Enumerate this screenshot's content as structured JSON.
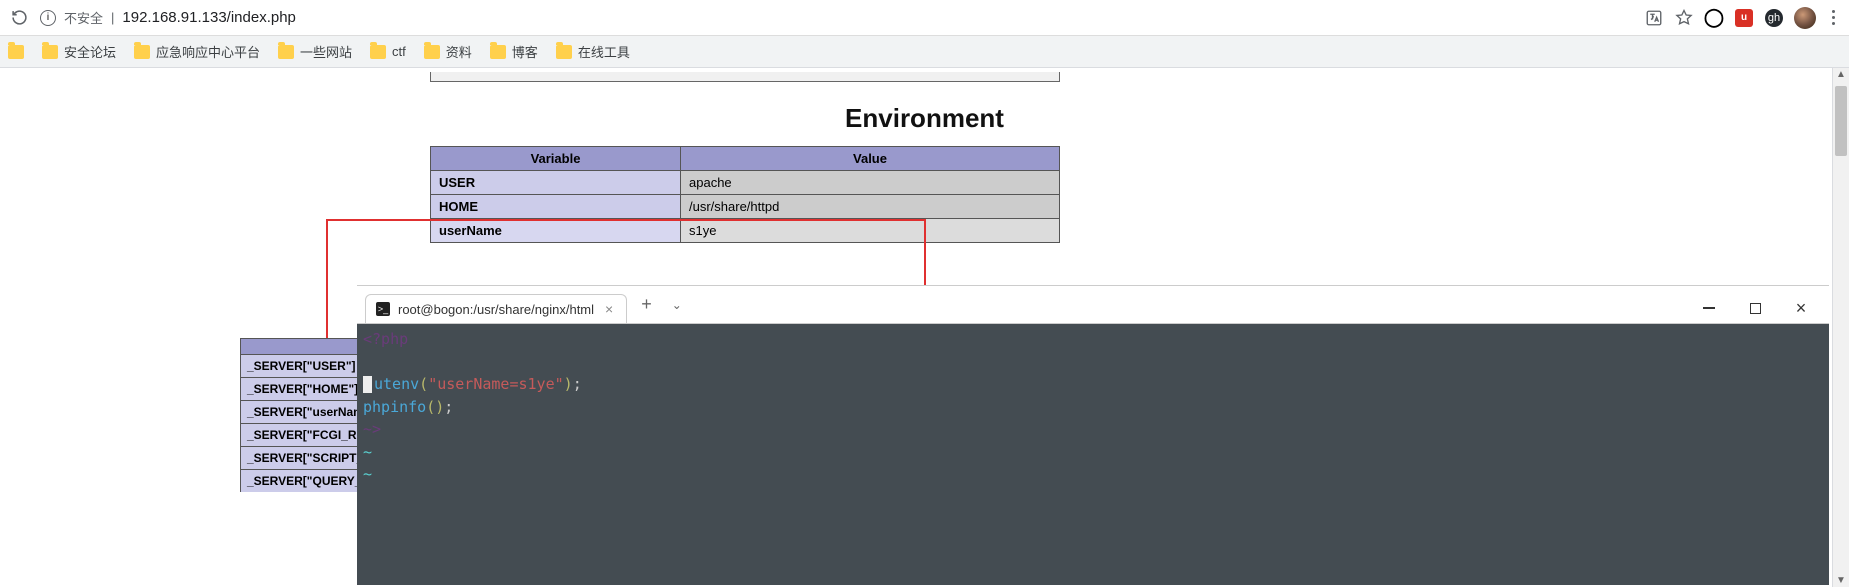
{
  "browser": {
    "insecure_label": "不安全",
    "url": "192.168.91.133/index.php",
    "bookmarks": [
      {
        "label": "安全论坛"
      },
      {
        "label": "应急响应中心平台"
      },
      {
        "label": "一些网站"
      },
      {
        "label": "ctf"
      },
      {
        "label": "资料"
      },
      {
        "label": "博客"
      },
      {
        "label": "在线工具"
      }
    ]
  },
  "page": {
    "env_heading": "Environment",
    "columns": {
      "var": "Variable",
      "val": "Value"
    },
    "env_rows": [
      {
        "var": "USER",
        "val": "apache"
      },
      {
        "var": "HOME",
        "val": "/usr/share/httpd"
      },
      {
        "var": "userName",
        "val": "s1ye"
      }
    ],
    "server_rows": [
      "_SERVER[\"USER\"]",
      "_SERVER[\"HOME\"]",
      "_SERVER[\"userName\"]",
      "_SERVER[\"FCGI_ROLE\"]",
      "_SERVER[\"SCRIPT_FILENAME\"]",
      "_SERVER[\"QUERY_STRING\"]"
    ]
  },
  "terminal": {
    "tab_title": "root@bogon:/usr/share/nginx/html",
    "code": {
      "open": "<?php",
      "fn1": "utenv",
      "arg1": "\"userName=s1ye\"",
      "fn2": "phpinfo",
      "prompt": "~>",
      "tilde": "~"
    }
  }
}
